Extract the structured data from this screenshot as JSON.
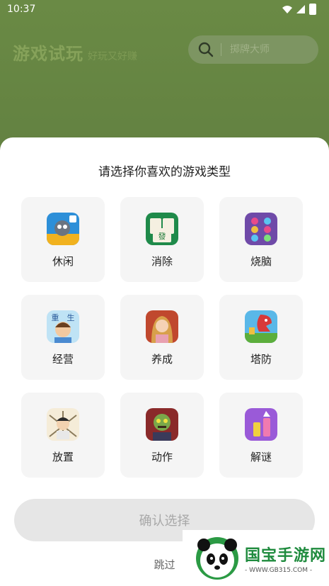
{
  "status_bar": {
    "time": "10:37"
  },
  "header": {
    "title": "游戏试玩",
    "subtitle": "好玩又好赚"
  },
  "search": {
    "placeholder": "掷牌大师"
  },
  "sheet": {
    "title": "请选择你喜欢的游戏类型",
    "categories": [
      {
        "label": "休闲",
        "icon": "casual-game-icon"
      },
      {
        "label": "消除",
        "icon": "mahjong-icon"
      },
      {
        "label": "烧脑",
        "icon": "puzzle-icon"
      },
      {
        "label": "经营",
        "icon": "business-icon"
      },
      {
        "label": "养成",
        "icon": "raising-icon"
      },
      {
        "label": "塔防",
        "icon": "tower-defense-icon"
      },
      {
        "label": "放置",
        "icon": "idle-icon"
      },
      {
        "label": "动作",
        "icon": "action-icon"
      },
      {
        "label": "解谜",
        "icon": "riddle-icon"
      }
    ],
    "confirm_label": "确认选择",
    "skip_label": "跳过"
  },
  "watermark": {
    "main": "国宝手游网",
    "url": "- WWW.GB315.COM -"
  },
  "colors": {
    "accent": "#86a25a",
    "card_bg": "#f5f5f5",
    "button_bg": "#e6e6e6",
    "watermark": "#1f8b3e"
  }
}
